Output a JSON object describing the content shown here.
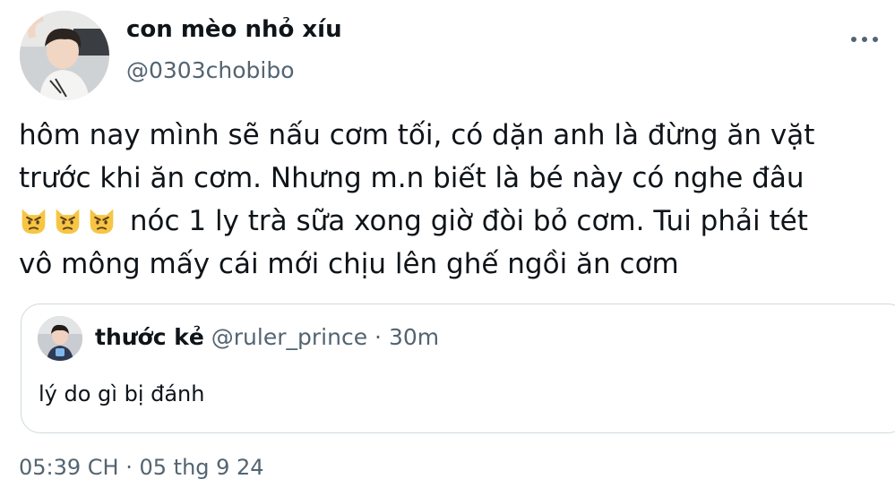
{
  "author": {
    "display_name": "con mèo nhỏ xíu",
    "handle": "@0303chobibo",
    "avatar_icon": "profile-photo-boy-with-headset"
  },
  "more_icon": "more-horizontal-icon",
  "tweet": {
    "lines": [
      "hôm nay mình sẽ nấu cơm tối, có dặn anh là đừng ăn vặt",
      "trước khi ăn cơm. Nhưng m.n biết là bé này có nghe đâu",
      "nóc 1 ly trà sữa xong giờ đòi bỏ cơm. Tui phải tét",
      "vô mông mấy cái mới chịu lên ghế ngồi ăn cơm"
    ],
    "emoji_icon": "pouting-cat-emoji"
  },
  "quoted": {
    "display_name": "thước kẻ",
    "handle": "@ruler_prince",
    "separator": "·",
    "time": "30m",
    "text": "lý do gì bị đánh",
    "avatar_icon": "profile-photo-small"
  },
  "timestamp": "05:39 CH · 05 thg 9 24"
}
